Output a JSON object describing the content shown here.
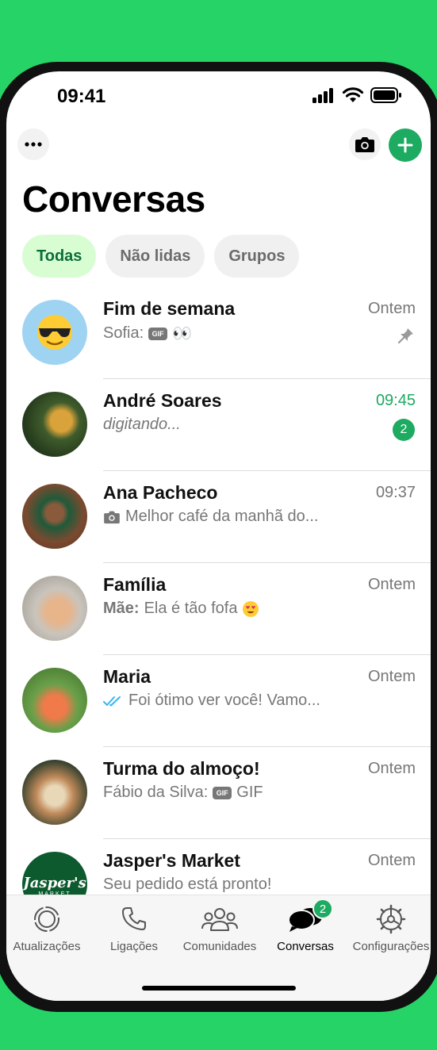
{
  "status": {
    "time": "09:41"
  },
  "header": {
    "title": "Conversas"
  },
  "filters": [
    {
      "label": "Todas",
      "active": true
    },
    {
      "label": "Não lidas",
      "active": false
    },
    {
      "label": "Grupos",
      "active": false
    }
  ],
  "chats": [
    {
      "name": "Fim de semana",
      "time": "Ontem",
      "sender": "Sofia:",
      "preview_icon": "gif-tag",
      "preview_text": "👀",
      "meta": "pin-icon"
    },
    {
      "name": "André Soares",
      "time": "09:45",
      "preview_text": "digitando...",
      "unread": "2"
    },
    {
      "name": "Ana Pacheco",
      "time": "09:37",
      "preview_icon": "camera-icon",
      "preview_text": "Melhor café da manhã do..."
    },
    {
      "name": "Família",
      "time": "Ontem",
      "sender": "Mãe:",
      "preview_text": "Ela é tão fofa",
      "preview_emoji": "heart-eyes-emoji"
    },
    {
      "name": "Maria",
      "time": "Ontem",
      "preview_icon": "double-check-icon",
      "preview_text": "Foi ótimo ver você! Vamo..."
    },
    {
      "name": "Turma do almoço!",
      "time": "Ontem",
      "sender": "Fábio da Silva:",
      "preview_icon": "gif-tag",
      "preview_text": "GIF"
    },
    {
      "name": "Jasper's Market",
      "time": "Ontem",
      "preview_text": "Seu pedido está pronto!",
      "avatar_text": "Jasper's",
      "avatar_subtext": "MARKET"
    }
  ],
  "gif_label": "GIF",
  "tabs": [
    {
      "label": "Atualizações",
      "icon": "updates-icon"
    },
    {
      "label": "Ligações",
      "icon": "phone-icon"
    },
    {
      "label": "Comunidades",
      "icon": "communities-icon"
    },
    {
      "label": "Conversas",
      "icon": "chats-icon",
      "active": true,
      "badge": "2"
    },
    {
      "label": "Configurações",
      "icon": "settings-icon"
    }
  ],
  "colors": {
    "brand": "#25d366",
    "accent": "#1daa61",
    "chip_active": "#d9fdd3",
    "read_ticks": "#34b7f1"
  }
}
